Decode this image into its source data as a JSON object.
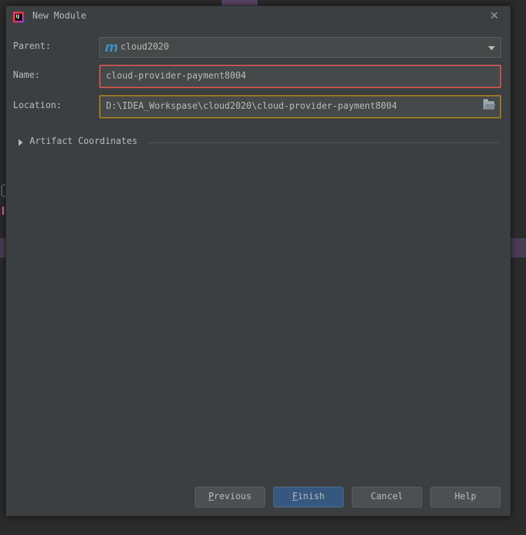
{
  "dialog": {
    "title": "New Module",
    "close_icon": "close-icon"
  },
  "form": {
    "parent": {
      "label": "Parent:",
      "value": "cloud2020",
      "icon": "maven-module-icon"
    },
    "name": {
      "label": "Name:",
      "value": "cloud-provider-payment8004",
      "state": "error"
    },
    "location": {
      "label": "Location:",
      "value": "D:\\IDEA_Workspase\\cloud2020\\cloud-provider-payment8004",
      "state": "warning",
      "icon": "folder-icon"
    }
  },
  "artifact_section": {
    "label": "Artifact Coordinates",
    "expanded": false
  },
  "buttons": {
    "previous": {
      "mnemonic": "P",
      "rest": "revious"
    },
    "finish": {
      "mnemonic": "F",
      "rest": "inish"
    },
    "cancel": "Cancel",
    "help": "Help"
  },
  "colors": {
    "dialog_bg": "#3c3f41",
    "field_bg": "#45494a",
    "error_border": "#c75450",
    "warning_border": "#9e7a23",
    "primary_button": "#365880",
    "maven_accent": "#3d8dbf"
  }
}
